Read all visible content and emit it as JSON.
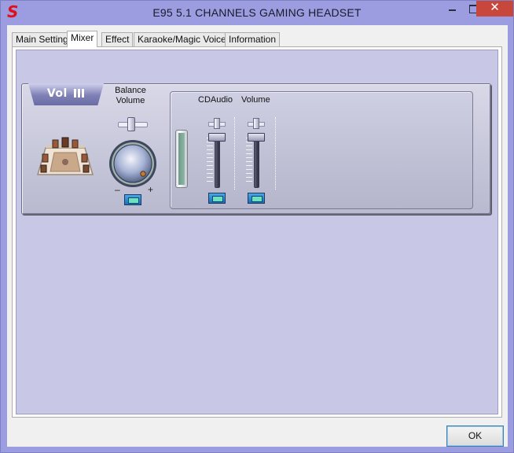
{
  "window": {
    "title": "E95 5.1 CHANNELS GAMING HEADSET",
    "app_icon_glyph": "S",
    "close_glyph": "✕"
  },
  "tabs": [
    {
      "label": "Main Setting",
      "active": false
    },
    {
      "label": "Mixer",
      "active": true
    },
    {
      "label": "Effect",
      "active": false
    },
    {
      "label": "Karaoke/Magic Voice",
      "active": false
    },
    {
      "label": "Information",
      "active": false
    }
  ],
  "mixer": {
    "badge_label": "Vol",
    "balance_label_line1": "Balance",
    "balance_label_line2": "Volume",
    "knob_minus": "–",
    "knob_plus": "+",
    "channels": [
      {
        "label": "CDAudio",
        "level": 1.0
      },
      {
        "label": "Volume",
        "level": 1.0
      }
    ]
  },
  "buttons": {
    "ok_label": "OK"
  },
  "colors": {
    "accent": "#9c9de0",
    "panel": "#c8c8e6",
    "close": "#c7473c"
  }
}
